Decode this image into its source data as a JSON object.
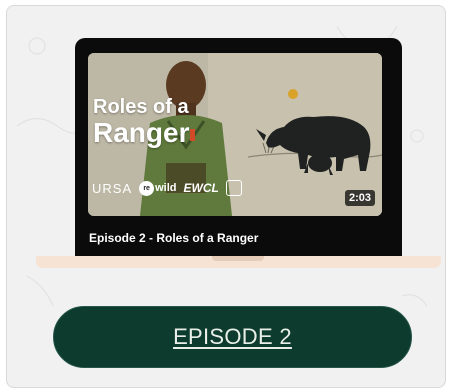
{
  "video": {
    "title_line1": "Roles of a",
    "title_line2": "Ranger",
    "duration": "2:03",
    "caption": "Episode 2 - Roles of a Ranger",
    "partners": {
      "ursa": "URSA",
      "rewild_badge": "re",
      "rewild": "wild",
      "ewcl": "EWCL"
    }
  },
  "episode_button": {
    "label": "EPISODE 2"
  },
  "colors": {
    "card_background": "#f1f1f1",
    "button_background": "#0d3b2e",
    "button_text": "#e9efe8",
    "laptop_base": "#f6e3d3",
    "video_background": "#bdb7a5",
    "title_accent": "#d24a28"
  },
  "icons": {
    "crest": "crest-logo-icon",
    "ranger": "ranger-illustration",
    "rhino": "rhino-illustration",
    "sun": "sun-icon"
  }
}
